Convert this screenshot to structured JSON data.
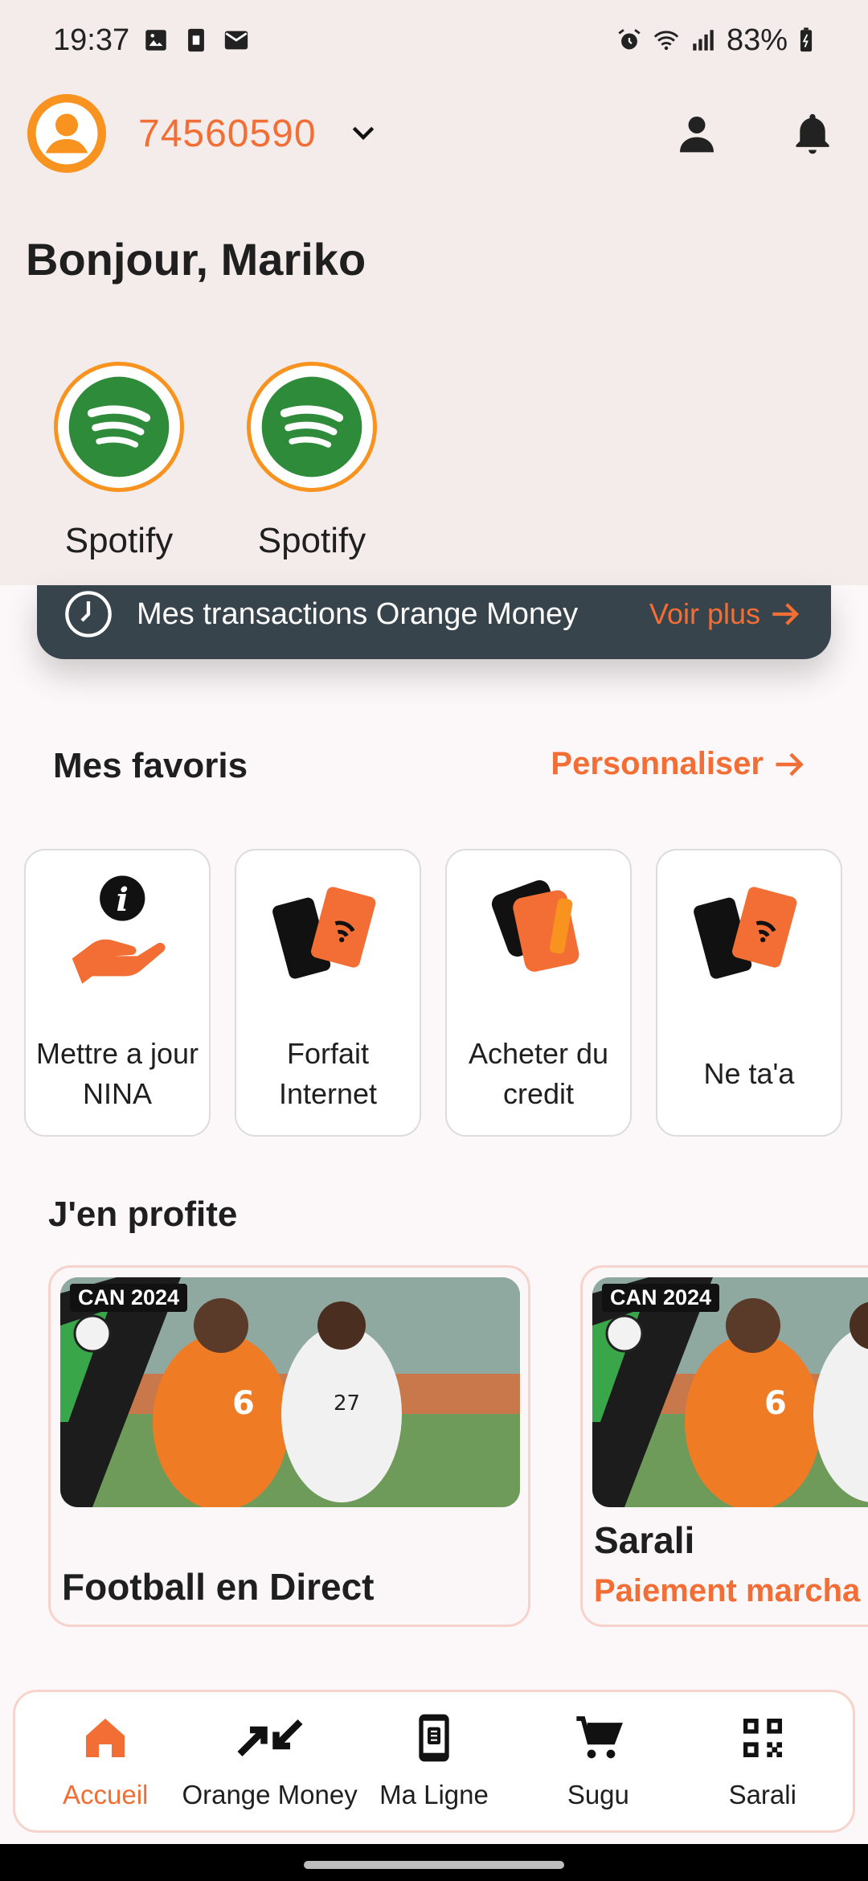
{
  "status_bar": {
    "time": "19:37",
    "battery": "83%",
    "icons": [
      "gallery-icon",
      "sim-icon",
      "mail-icon",
      "alarm-icon",
      "wifi-icon",
      "signal-icon",
      "battery-icon"
    ]
  },
  "header": {
    "phone_number": "74560590",
    "greeting": "Bonjour, Mariko"
  },
  "shortcuts": [
    {
      "label": "Spotify",
      "icon": "spotify-icon"
    },
    {
      "label": "Spotify",
      "icon": "spotify-icon"
    }
  ],
  "transactions": {
    "label": "Mes transactions Orange Money",
    "more": "Voir plus"
  },
  "favoris": {
    "title": "Mes favoris",
    "action": "Personnaliser",
    "items": [
      {
        "label": "Mettre a jour NINA",
        "icon": "info-hand-icon"
      },
      {
        "label": "Forfait Internet",
        "icon": "phone-wifi-icon"
      },
      {
        "label": "Acheter du credit",
        "icon": "credit-cards-icon"
      },
      {
        "label": "Ne ta'a",
        "icon": "phone-wifi-icon"
      }
    ]
  },
  "profite": {
    "title": "J'en profite",
    "cards": [
      {
        "tag": "CAN 2024",
        "title": "Football en Direct"
      },
      {
        "tag": "CAN 2024",
        "title": "Sarali",
        "subtitle": "Paiement marcha"
      }
    ]
  },
  "bottom_nav": {
    "items": [
      {
        "label": "Accueil",
        "icon": "home-icon",
        "active": true
      },
      {
        "label": "Orange Money",
        "icon": "transfer-arrows-icon"
      },
      {
        "label": "Ma Ligne",
        "icon": "sim-phone-icon"
      },
      {
        "label": "Sugu",
        "icon": "cart-icon"
      },
      {
        "label": "Sarali",
        "icon": "qr-code-icon"
      }
    ]
  },
  "colors": {
    "accent": "#f26e35",
    "brand_orange": "#f7931e",
    "banner_dark": "#37444b",
    "spotify_green": "#2e8b3a"
  }
}
